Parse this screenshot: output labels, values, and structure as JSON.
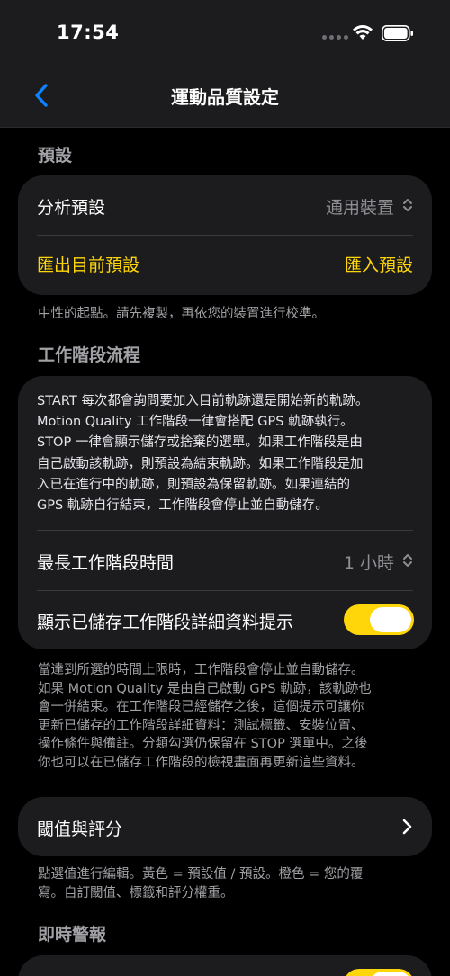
{
  "status_bar": {
    "time": "17:54"
  },
  "nav": {
    "title": "運動品質設定"
  },
  "presets": {
    "header": "預設",
    "analysis_label": "分析預設",
    "analysis_value": "通用裝置",
    "export_label": "匯出目前預設",
    "import_label": "匯入預設",
    "footer": "中性的起點。請先複製，再依您的裝置進行校準。"
  },
  "workflow": {
    "header": "工作階段流程",
    "description_lines": [
      "START 每次都會詢問要加入目前軌跡還是開始新的軌跡。",
      "Motion Quality 工作階段一律會搭配 GPS 軌跡執行。",
      "STOP 一律會顯示儲存或捨棄的選單。如果工作階段是由",
      "自己啟動該軌跡，則預設為結束軌跡。如果工作階段是加",
      "入已在進行中的軌跡，則預設為保留軌跡。如果連結的",
      "GPS 軌跡自行結束，工作階段會停止並自動儲存。"
    ],
    "max_duration_label": "最長工作階段時間",
    "max_duration_value": "1 小時",
    "show_prompt_label": "顯示已儲存工作階段詳細資料提示",
    "show_prompt_on": true,
    "footer_lines": [
      "當達到所選的時間上限時，工作階段會停止並自動儲存。",
      "如果 Motion Quality 是由自己啟動 GPS 軌跡，該軌跡也",
      "會一併結束。在工作階段已經儲存之後，這個提示可讓你",
      "更新已儲存的工作階段詳細資料：測試標籤、安裝位置、",
      "操作條件與備註。分類勾選仍保留在 STOP 選單中。之後",
      "你也可以在已儲存工作階段的檢視畫面再更新這些資料。"
    ]
  },
  "thresholds": {
    "label": "閾值與評分",
    "footer_lines": [
      "點選值進行編輯。黃色 = 預設值 / 預設。橙色 = 您的覆",
      "寫。自訂閾值、標籤和評分權重。"
    ]
  },
  "alerts": {
    "header": "即時警報"
  },
  "colors": {
    "accent": "#ffd60a",
    "link_blue": "#0a84ff",
    "card_bg": "#1c1c1e",
    "secondary_text": "#a1a1a6"
  }
}
